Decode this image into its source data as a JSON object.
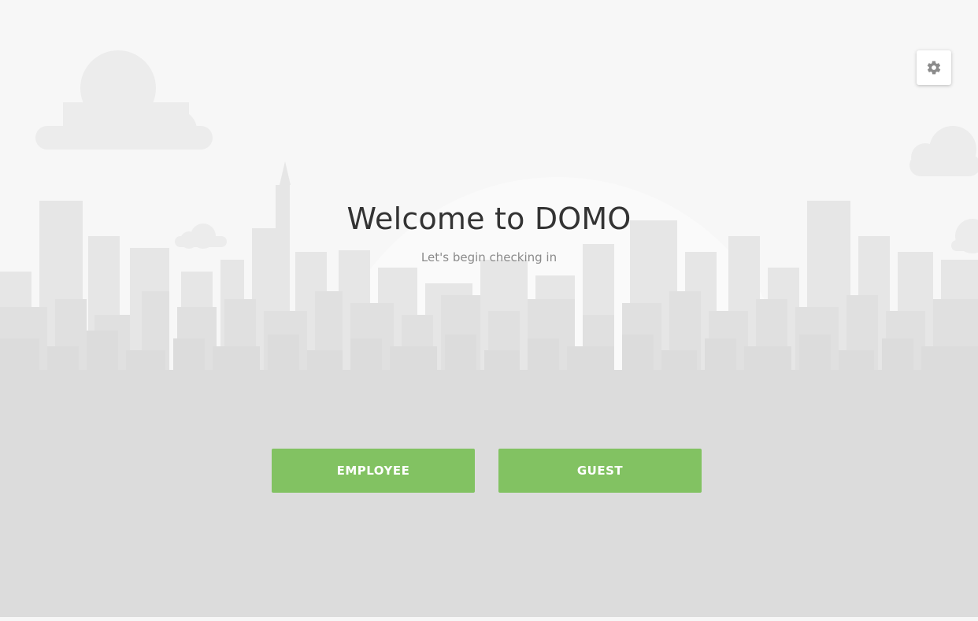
{
  "app": {
    "title": "Welcome to DOMO",
    "subtitle": "Let's begin checking in"
  },
  "actions": {
    "employee_label": "EMPLOYEE",
    "guest_label": "GUEST"
  },
  "toolbar": {
    "settings_icon": "gear-icon"
  },
  "colors": {
    "background": "#f7f7f7",
    "skyline": "#e4e4e4",
    "ground": "#dcdcdc",
    "accent_green": "#82c262",
    "title_text": "#333333",
    "subtitle_text": "#8a8a8a"
  }
}
